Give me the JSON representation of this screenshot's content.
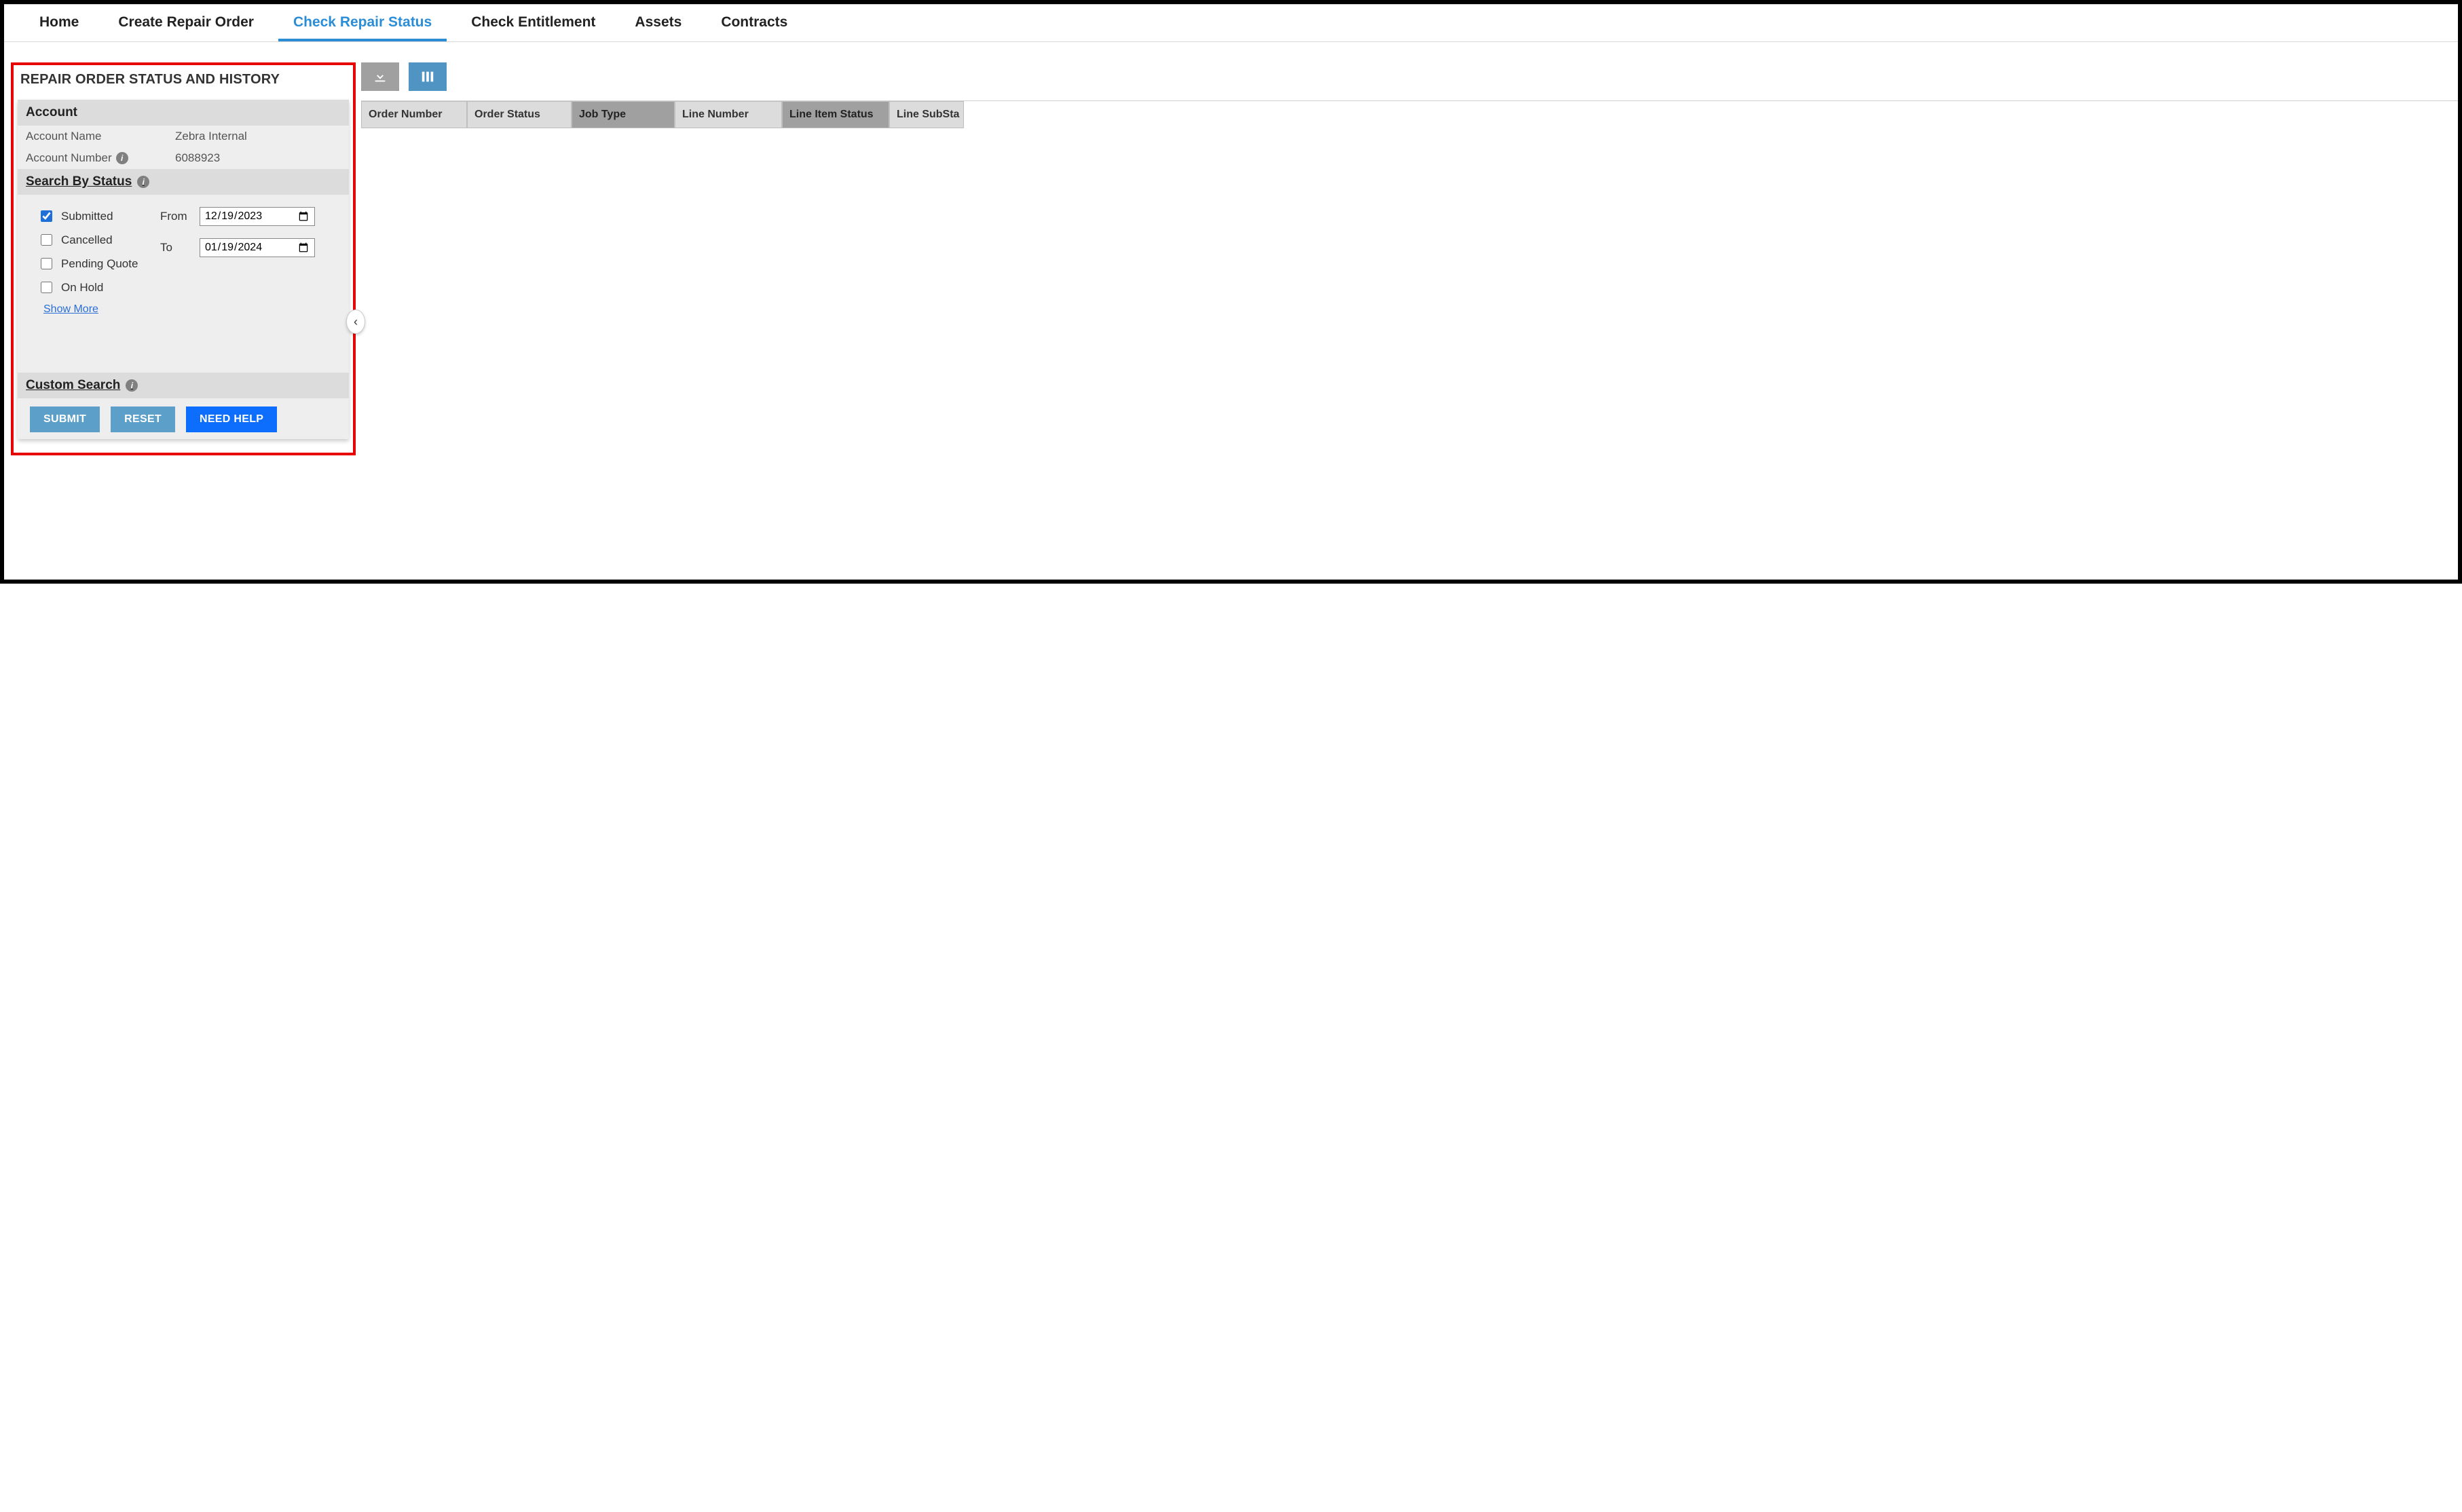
{
  "nav": {
    "tabs": [
      {
        "label": "Home",
        "active": false
      },
      {
        "label": "Create Repair Order",
        "active": false
      },
      {
        "label": "Check Repair Status",
        "active": true
      },
      {
        "label": "Check Entitlement",
        "active": false
      },
      {
        "label": "Assets",
        "active": false
      },
      {
        "label": "Contracts",
        "active": false
      }
    ]
  },
  "panel": {
    "title": "REPAIR ORDER STATUS AND HISTORY",
    "account": {
      "header": "Account",
      "name_label": "Account Name",
      "name_value": "Zebra Internal",
      "number_label": "Account Number",
      "number_value": "6088923"
    },
    "search_by_status": {
      "header": "Search By Status",
      "options": [
        {
          "label": "Submitted",
          "checked": true
        },
        {
          "label": "Cancelled",
          "checked": false
        },
        {
          "label": "Pending Quote",
          "checked": false
        },
        {
          "label": "On Hold",
          "checked": false
        }
      ],
      "from_label": "From",
      "from_value": "2023-12-19",
      "to_label": "To",
      "to_value": "2024-01-19",
      "show_more": "Show More"
    },
    "custom_search": {
      "header": "Custom Search"
    },
    "buttons": {
      "submit": "SUBMIT",
      "reset": "RESET",
      "help": "NEED HELP"
    },
    "collapse_glyph": "‹"
  },
  "toolbar": {
    "download_icon": "download",
    "columns_icon": "columns"
  },
  "table": {
    "headers": [
      {
        "label": "Order Number",
        "dark": false,
        "wclass": "w-on"
      },
      {
        "label": "Order Status",
        "dark": false,
        "wclass": "w-os"
      },
      {
        "label": "Job Type",
        "dark": true,
        "wclass": "w-jt"
      },
      {
        "label": "Line Number",
        "dark": false,
        "wclass": "w-ln"
      },
      {
        "label": "Line Item Status",
        "dark": true,
        "wclass": "w-li"
      },
      {
        "label": "Line SubSta",
        "dark": false,
        "wclass": "w-ls"
      }
    ]
  }
}
